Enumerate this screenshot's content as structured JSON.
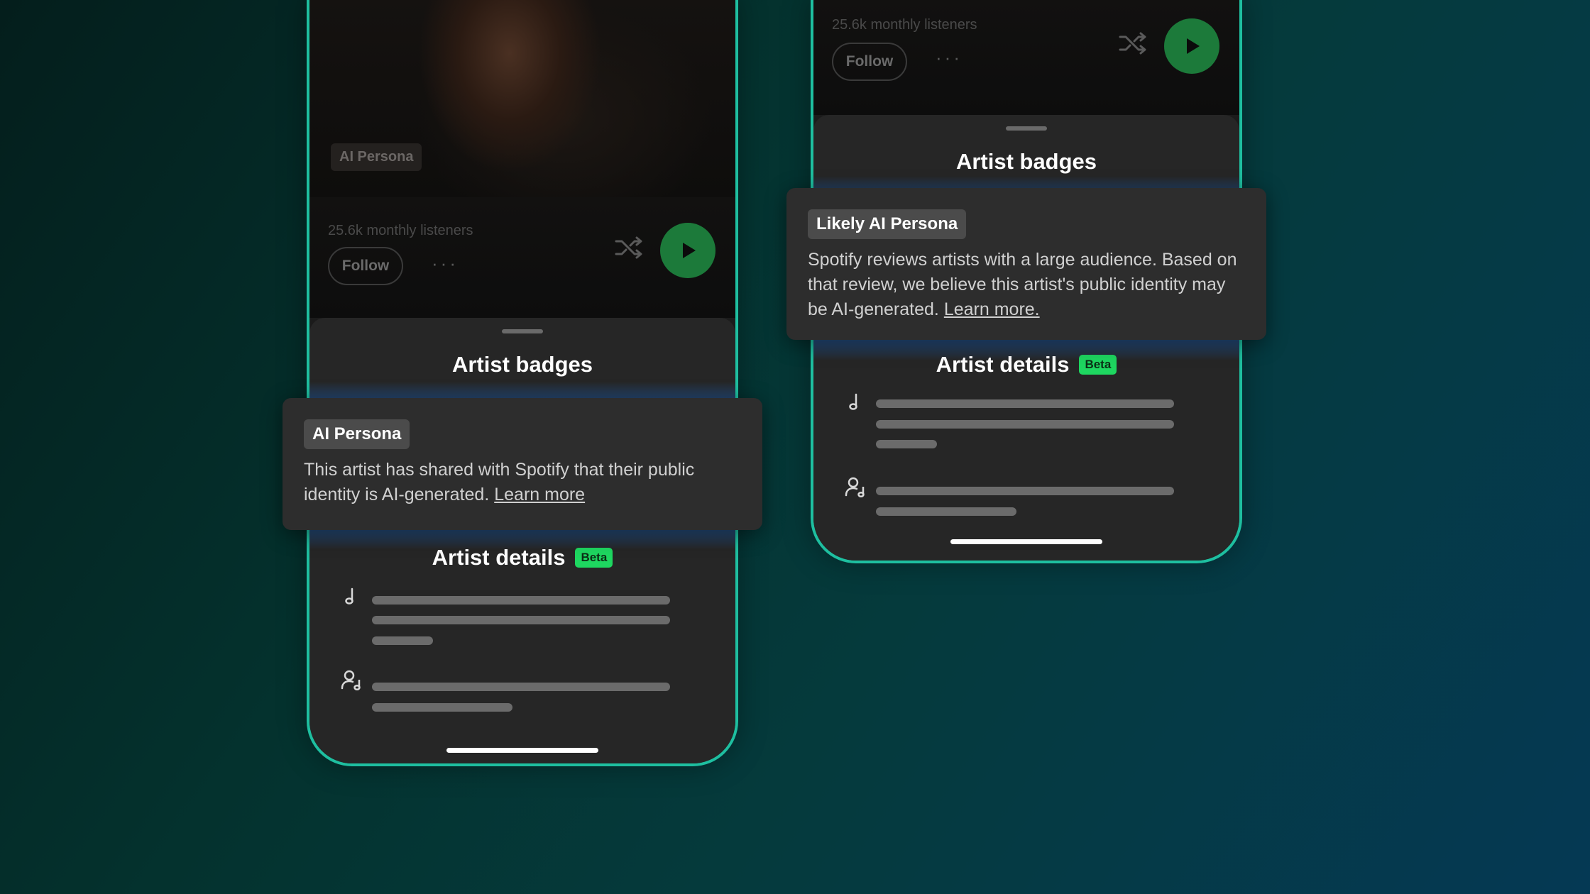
{
  "colors": {
    "accent_green": "#1ed760",
    "phone_border": "#1ebfa0",
    "sheet_bg": "#262626",
    "card_bg": "#2d2d2d"
  },
  "phones": [
    {
      "hero_badge": "AI Persona",
      "monthly_listeners": "25.6k monthly listeners",
      "follow_label": "Follow",
      "more_label": "···",
      "sheet_title": "Artist badges",
      "details_title": "Artist details",
      "beta_label": "Beta",
      "icons": [
        "more-icon",
        "shuffle-icon",
        "play-icon",
        "music-note-icon",
        "person-music-icon"
      ]
    },
    {
      "monthly_listeners": "25.6k monthly listeners",
      "follow_label": "Follow",
      "more_label": "···",
      "sheet_title": "Artist badges",
      "details_title": "Artist details",
      "beta_label": "Beta",
      "icons": [
        "more-icon",
        "shuffle-icon",
        "play-icon",
        "music-note-icon",
        "person-music-icon"
      ]
    }
  ],
  "cards": [
    {
      "badge": "AI Persona",
      "text": "This artist has shared with Spotify that their public identity is AI-generated.",
      "link": "Learn more"
    },
    {
      "badge": "Likely AI Persona",
      "text": "Spotify reviews artists with a large audience. Based on that review, we believe this artist's public identity may be AI-generated.",
      "link": "Learn more."
    }
  ]
}
